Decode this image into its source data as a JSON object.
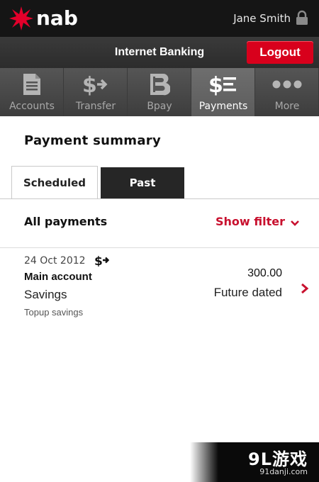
{
  "header": {
    "brand": "nab",
    "user_name": "Jane Smith",
    "title": "Internet Banking",
    "logout_label": "Logout"
  },
  "nav": [
    {
      "label": "Accounts",
      "icon": "document-icon",
      "active": false
    },
    {
      "label": "Transfer",
      "icon": "dollar-arrow-icon",
      "active": false
    },
    {
      "label": "Bpay",
      "icon": "bpay-icon",
      "active": false
    },
    {
      "label": "Payments",
      "icon": "dollar-list-icon",
      "active": true
    },
    {
      "label": "More",
      "icon": "more-dots-icon",
      "active": false
    }
  ],
  "main": {
    "title": "Payment summary",
    "tabs": [
      {
        "label": "Scheduled",
        "active": true
      },
      {
        "label": "Past",
        "active": false
      }
    ],
    "filter_heading": "All payments",
    "show_filter_label": "Show filter",
    "payments": [
      {
        "date": "24 Oct 2012",
        "type_icon": "transfer-icon",
        "account": "Main account",
        "account_type": "Savings",
        "description": "Topup savings",
        "amount": "300.00",
        "status": "Future dated"
      }
    ]
  },
  "watermark": {
    "logo": "9L游戏",
    "url": "91danji.com"
  },
  "colors": {
    "brand_red": "#d8001c",
    "accent_red": "#c8102e",
    "top_bar": "#151515",
    "nav_bg": "#444444"
  }
}
